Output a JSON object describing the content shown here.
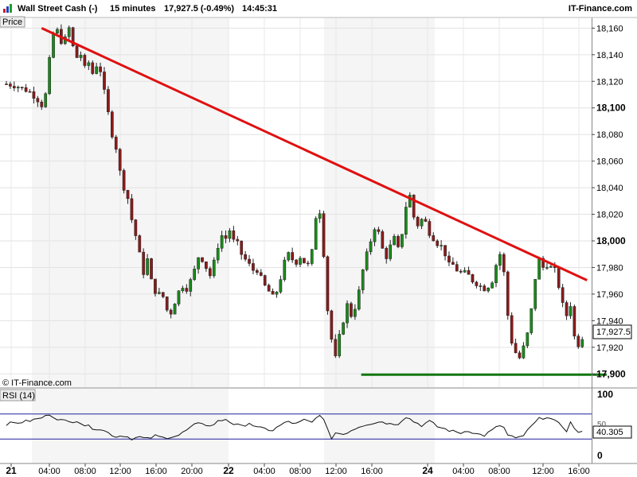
{
  "header": {
    "instrument": "Wall Street Cash (-)",
    "timeframe": "15 minutes",
    "last_quote": "17,927.5 (-0.49%)",
    "time": "14:45:31",
    "site": "IT-Finance.com"
  },
  "price_panel": {
    "label": "Price",
    "copyright": "© IT-Finance.com",
    "last_price_badge": "17,927.5"
  },
  "rsi_panel": {
    "label": "RSI (14)",
    "value_badge": "40.305",
    "axis_labels": [
      "100",
      "50",
      "0"
    ]
  },
  "colors": {
    "up_candle": "#1a8a1a",
    "down_candle": "#8b1a1a",
    "trendline": "#e01010",
    "support": "#117711",
    "rsi_band": "#2020a0"
  },
  "chart_data": [
    {
      "type": "candlestick",
      "title": "Wall Street Cash (-) 15 minutes",
      "ylabel": "Price",
      "ylim": [
        17890,
        18168
      ],
      "y_ticks": [
        {
          "label": "18,160",
          "value": 18160,
          "bold": false
        },
        {
          "label": "18,140",
          "value": 18140,
          "bold": false
        },
        {
          "label": "18,120",
          "value": 18120,
          "bold": false
        },
        {
          "label": "18,100",
          "value": 18100,
          "bold": true
        },
        {
          "label": "18,080",
          "value": 18080,
          "bold": false
        },
        {
          "label": "18,060",
          "value": 18060,
          "bold": false
        },
        {
          "label": "18,040",
          "value": 18040,
          "bold": false
        },
        {
          "label": "18,020",
          "value": 18020,
          "bold": false
        },
        {
          "label": "18,000",
          "value": 18000,
          "bold": true
        },
        {
          "label": "17,980",
          "value": 17980,
          "bold": false
        },
        {
          "label": "17,960",
          "value": 17960,
          "bold": false
        },
        {
          "label": "17,940",
          "value": 17940,
          "bold": false
        },
        {
          "label": "17,920",
          "value": 17920,
          "bold": false
        },
        {
          "label": "17,900",
          "value": 17900,
          "bold": true
        }
      ],
      "x_ticks": [
        {
          "label": "21",
          "bold": true
        },
        {
          "label": "04:00",
          "bold": false
        },
        {
          "label": "08:00",
          "bold": false
        },
        {
          "label": "12:00",
          "bold": false
        },
        {
          "label": "16:00",
          "bold": false
        },
        {
          "label": "20:00",
          "bold": false
        },
        {
          "label": "22",
          "bold": true
        },
        {
          "label": "04:00",
          "bold": false
        },
        {
          "label": "08:00",
          "bold": false
        },
        {
          "label": "12:00",
          "bold": false
        },
        {
          "label": "16:00",
          "bold": false
        },
        {
          "label": "24",
          "bold": true
        },
        {
          "label": "04:00",
          "bold": false
        },
        {
          "label": "08:00",
          "bold": false
        },
        {
          "label": "12:00",
          "bold": false
        },
        {
          "label": "16:00",
          "bold": false
        }
      ],
      "close_path": [
        [
          0,
          18118
        ],
        [
          3,
          18116
        ],
        [
          6,
          18112
        ],
        [
          8,
          18106
        ],
        [
          9,
          18102
        ],
        [
          10,
          18110
        ],
        [
          11,
          18136
        ],
        [
          12,
          18156
        ],
        [
          13,
          18158
        ],
        [
          14,
          18150
        ],
        [
          15,
          18152
        ],
        [
          16,
          18160
        ],
        [
          17,
          18146
        ],
        [
          18,
          18138
        ],
        [
          19,
          18140
        ],
        [
          20,
          18130
        ],
        [
          21,
          18134
        ],
        [
          22,
          18126
        ],
        [
          23,
          18132
        ],
        [
          24,
          18128
        ],
        [
          25,
          18112
        ],
        [
          26,
          18096
        ],
        [
          27,
          18080
        ],
        [
          28,
          18070
        ],
        [
          29,
          18052
        ],
        [
          30,
          18040
        ],
        [
          31,
          18032
        ],
        [
          32,
          18016
        ],
        [
          33,
          18004
        ],
        [
          34,
          17990
        ],
        [
          35,
          17976
        ],
        [
          36,
          17986
        ],
        [
          37,
          17970
        ],
        [
          38,
          17962
        ],
        [
          40,
          17958
        ],
        [
          41,
          17948
        ],
        [
          42,
          17946
        ],
        [
          43,
          17954
        ],
        [
          44,
          17962
        ],
        [
          45,
          17966
        ],
        [
          46,
          17964
        ],
        [
          47,
          17970
        ],
        [
          48,
          17978
        ],
        [
          49,
          17988
        ],
        [
          50,
          17986
        ],
        [
          51,
          17980
        ],
        [
          52,
          17974
        ],
        [
          53,
          17984
        ],
        [
          54,
          17996
        ],
        [
          55,
          18004
        ],
        [
          56,
          18002
        ],
        [
          57,
          18008
        ],
        [
          58,
          18000
        ],
        [
          59,
          17998
        ],
        [
          60,
          17990
        ],
        [
          61,
          17986
        ],
        [
          62,
          17982
        ],
        [
          63,
          17978
        ],
        [
          64,
          17978
        ],
        [
          65,
          17972
        ],
        [
          66,
          17966
        ],
        [
          67,
          17962
        ],
        [
          68,
          17958
        ],
        [
          69,
          17962
        ],
        [
          70,
          17972
        ],
        [
          71,
          17984
        ],
        [
          72,
          17990
        ],
        [
          73,
          17986
        ],
        [
          74,
          17984
        ],
        [
          75,
          17988
        ],
        [
          76,
          17984
        ],
        [
          77,
          17982
        ],
        [
          78,
          17992
        ],
        [
          79,
          18018
        ],
        [
          80,
          18022
        ],
        [
          81,
          17990
        ],
        [
          82,
          17948
        ],
        [
          83,
          17926
        ],
        [
          84,
          17912
        ],
        [
          85,
          17928
        ],
        [
          86,
          17940
        ],
        [
          87,
          17952
        ],
        [
          88,
          17944
        ],
        [
          89,
          17950
        ],
        [
          90,
          17962
        ],
        [
          91,
          17978
        ],
        [
          92,
          17990
        ],
        [
          93,
          18000
        ],
        [
          94,
          18010
        ],
        [
          95,
          18006
        ],
        [
          96,
          17994
        ],
        [
          97,
          17988
        ],
        [
          98,
          17996
        ],
        [
          99,
          18002
        ],
        [
          100,
          17994
        ],
        [
          101,
          18006
        ],
        [
          102,
          18026
        ],
        [
          103,
          18034
        ],
        [
          104,
          18018
        ],
        [
          105,
          18012
        ],
        [
          106,
          18016
        ],
        [
          107,
          18014
        ],
        [
          108,
          18006
        ],
        [
          109,
          18002
        ],
        [
          110,
          17998
        ],
        [
          111,
          17996
        ],
        [
          112,
          17990
        ],
        [
          113,
          17982
        ],
        [
          114,
          17982
        ],
        [
          115,
          17978
        ],
        [
          116,
          17976
        ],
        [
          117,
          17976
        ],
        [
          118,
          17974
        ],
        [
          119,
          17970
        ],
        [
          120,
          17968
        ],
        [
          121,
          17966
        ],
        [
          122,
          17964
        ],
        [
          123,
          17966
        ],
        [
          124,
          17970
        ],
        [
          125,
          17982
        ],
        [
          126,
          17990
        ],
        [
          127,
          17976
        ],
        [
          128,
          17944
        ],
        [
          129,
          17924
        ],
        [
          130,
          17916
        ],
        [
          131,
          17912
        ],
        [
          132,
          17920
        ],
        [
          133,
          17930
        ],
        [
          134,
          17948
        ],
        [
          135,
          17972
        ],
        [
          136,
          17986
        ],
        [
          137,
          17980
        ],
        [
          138,
          17982
        ],
        [
          139,
          17980
        ],
        [
          140,
          17978
        ],
        [
          141,
          17966
        ],
        [
          142,
          17952
        ],
        [
          143,
          17944
        ],
        [
          144,
          17952
        ],
        [
          145,
          17928
        ],
        [
          146,
          17922
        ],
        [
          147,
          17927.5
        ]
      ],
      "annotations": [
        {
          "type": "line",
          "name": "descending trendline",
          "from": [
            9,
            18160
          ],
          "to": [
            147,
            17974
          ]
        },
        {
          "type": "line",
          "name": "horizontal support",
          "from": [
            92,
            17900
          ],
          "to": [
            151,
            17900
          ]
        }
      ],
      "last_price": 17927.5,
      "grid": true
    },
    {
      "type": "line",
      "title": "RSI (14)",
      "ylim": [
        0,
        100
      ],
      "bands": [
        30,
        70
      ],
      "y_ticks": [
        100,
        50,
        0
      ],
      "values": [
        [
          0,
          54
        ],
        [
          5,
          58
        ],
        [
          8,
          62
        ],
        [
          10,
          66
        ],
        [
          11,
          70
        ],
        [
          12,
          66
        ],
        [
          14,
          60
        ],
        [
          16,
          57
        ],
        [
          18,
          60
        ],
        [
          20,
          52
        ],
        [
          22,
          48
        ],
        [
          24,
          46
        ],
        [
          26,
          40
        ],
        [
          28,
          34
        ],
        [
          30,
          36
        ],
        [
          32,
          31
        ],
        [
          34,
          33
        ],
        [
          36,
          30
        ],
        [
          38,
          35
        ],
        [
          40,
          32
        ],
        [
          42,
          34
        ],
        [
          44,
          36
        ],
        [
          46,
          44
        ],
        [
          48,
          52
        ],
        [
          50,
          56
        ],
        [
          52,
          50
        ],
        [
          54,
          58
        ],
        [
          56,
          62
        ],
        [
          58,
          54
        ],
        [
          60,
          50
        ],
        [
          62,
          56
        ],
        [
          64,
          48
        ],
        [
          66,
          46
        ],
        [
          68,
          44
        ],
        [
          70,
          52
        ],
        [
          72,
          58
        ],
        [
          74,
          54
        ],
        [
          76,
          60
        ],
        [
          78,
          56
        ],
        [
          80,
          70
        ],
        [
          81,
          60
        ],
        [
          82,
          44
        ],
        [
          83,
          32
        ],
        [
          84,
          40
        ],
        [
          86,
          38
        ],
        [
          88,
          44
        ],
        [
          90,
          50
        ],
        [
          92,
          54
        ],
        [
          94,
          56
        ],
        [
          96,
          58
        ],
        [
          98,
          54
        ],
        [
          100,
          55
        ],
        [
          102,
          66
        ],
        [
          104,
          58
        ],
        [
          106,
          52
        ],
        [
          108,
          58
        ],
        [
          110,
          50
        ],
        [
          112,
          46
        ],
        [
          114,
          42
        ],
        [
          116,
          40
        ],
        [
          118,
          44
        ],
        [
          120,
          38
        ],
        [
          122,
          36
        ],
        [
          124,
          44
        ],
        [
          126,
          52
        ],
        [
          127,
          48
        ],
        [
          128,
          36
        ],
        [
          129,
          34
        ],
        [
          130,
          30
        ],
        [
          132,
          36
        ],
        [
          134,
          50
        ],
        [
          136,
          62
        ],
        [
          138,
          66
        ],
        [
          140,
          58
        ],
        [
          142,
          50
        ],
        [
          143,
          44
        ],
        [
          144,
          56
        ],
        [
          145,
          48
        ],
        [
          146,
          40
        ],
        [
          147,
          40.305
        ]
      ]
    }
  ]
}
